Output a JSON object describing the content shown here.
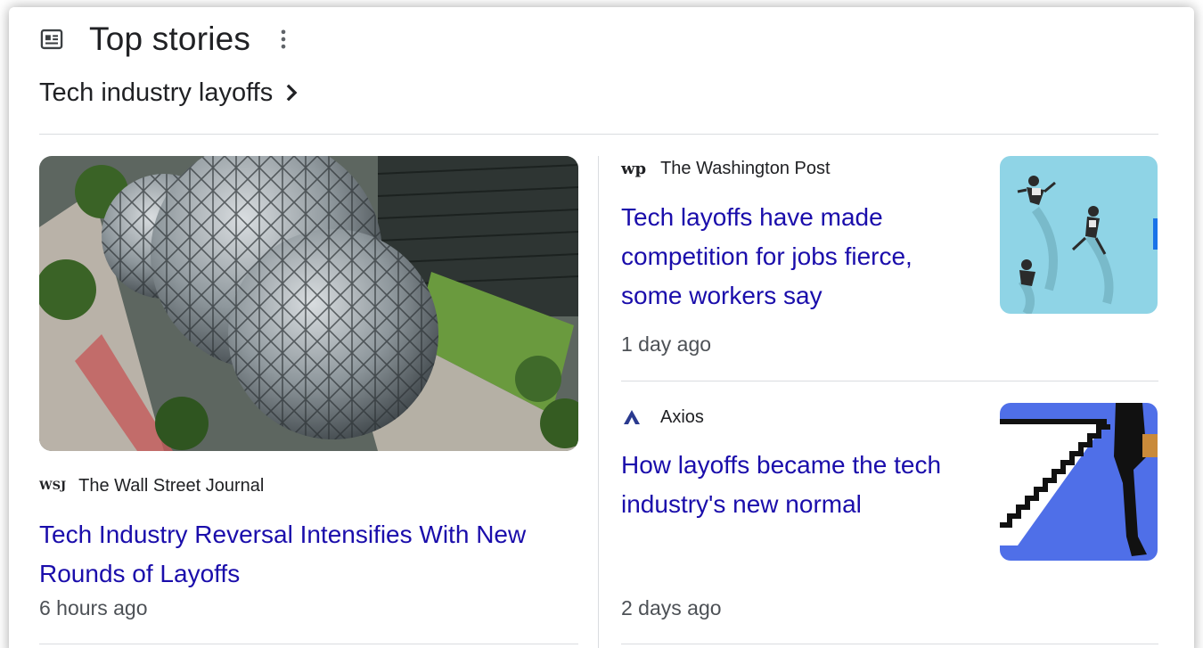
{
  "section": {
    "title": "Top stories",
    "icon": "newspaper-icon",
    "more_icon": "more-vert-icon"
  },
  "topic": {
    "label": "Tech industry layoffs",
    "icon": "chevron-right-icon"
  },
  "main_story": {
    "source_logo": "WSJ",
    "source": "The Wall Street Journal",
    "headline": "Tech Industry Reversal Intensifies With New Rounds of Layoffs",
    "time": "6 hours ago",
    "image": "glass-spheres-photo"
  },
  "side_stories": [
    {
      "source_logo": "wp",
      "source": "The Washington Post",
      "headline": "Tech layoffs have made competition for jobs fierce, some workers say",
      "time": "1 day ago",
      "image": "jumping-people-illustration"
    },
    {
      "source_logo": "axios-logo",
      "source": "Axios",
      "headline": "How layoffs became the tech industry's new normal",
      "time": "2 days ago",
      "image": "stairs-man-illustration"
    }
  ],
  "colors": {
    "headline": "#1a0dab",
    "text": "#202124",
    "meta": "#4d5156",
    "divider": "#dadce0"
  }
}
